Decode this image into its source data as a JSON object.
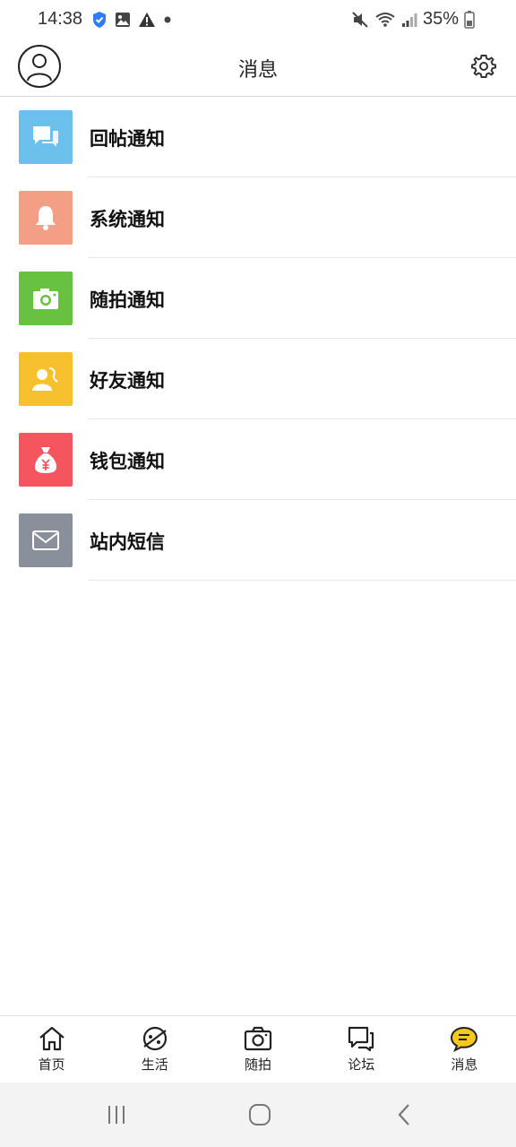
{
  "status": {
    "time": "14:38",
    "battery": "35%"
  },
  "header": {
    "title": "消息",
    "avatar_icon": "user-avatar-icon",
    "settings_icon": "gear-icon"
  },
  "notices": [
    {
      "label": "回帖通知",
      "icon": "chat-bubbles-icon",
      "color": "#6cc1ec"
    },
    {
      "label": "系统通知",
      "icon": "bell-icon",
      "color": "#f59e86"
    },
    {
      "label": "随拍通知",
      "icon": "camera-icon",
      "color": "#69c142"
    },
    {
      "label": "好友通知",
      "icon": "friends-icon",
      "color": "#f6c02f"
    },
    {
      "label": "钱包通知",
      "icon": "money-bag-icon",
      "color": "#f5555f"
    },
    {
      "label": "站内短信",
      "icon": "envelope-icon",
      "color": "#8a909b"
    }
  ],
  "tabs": [
    {
      "label": "首页",
      "icon": "home-icon",
      "active": false
    },
    {
      "label": "生活",
      "icon": "planet-icon",
      "active": false
    },
    {
      "label": "随拍",
      "icon": "camera-icon",
      "active": false
    },
    {
      "label": "论坛",
      "icon": "forum-icon",
      "active": false
    },
    {
      "label": "消息",
      "icon": "message-icon",
      "active": true
    }
  ],
  "colors": {
    "active_tab": "#f5c81e"
  }
}
